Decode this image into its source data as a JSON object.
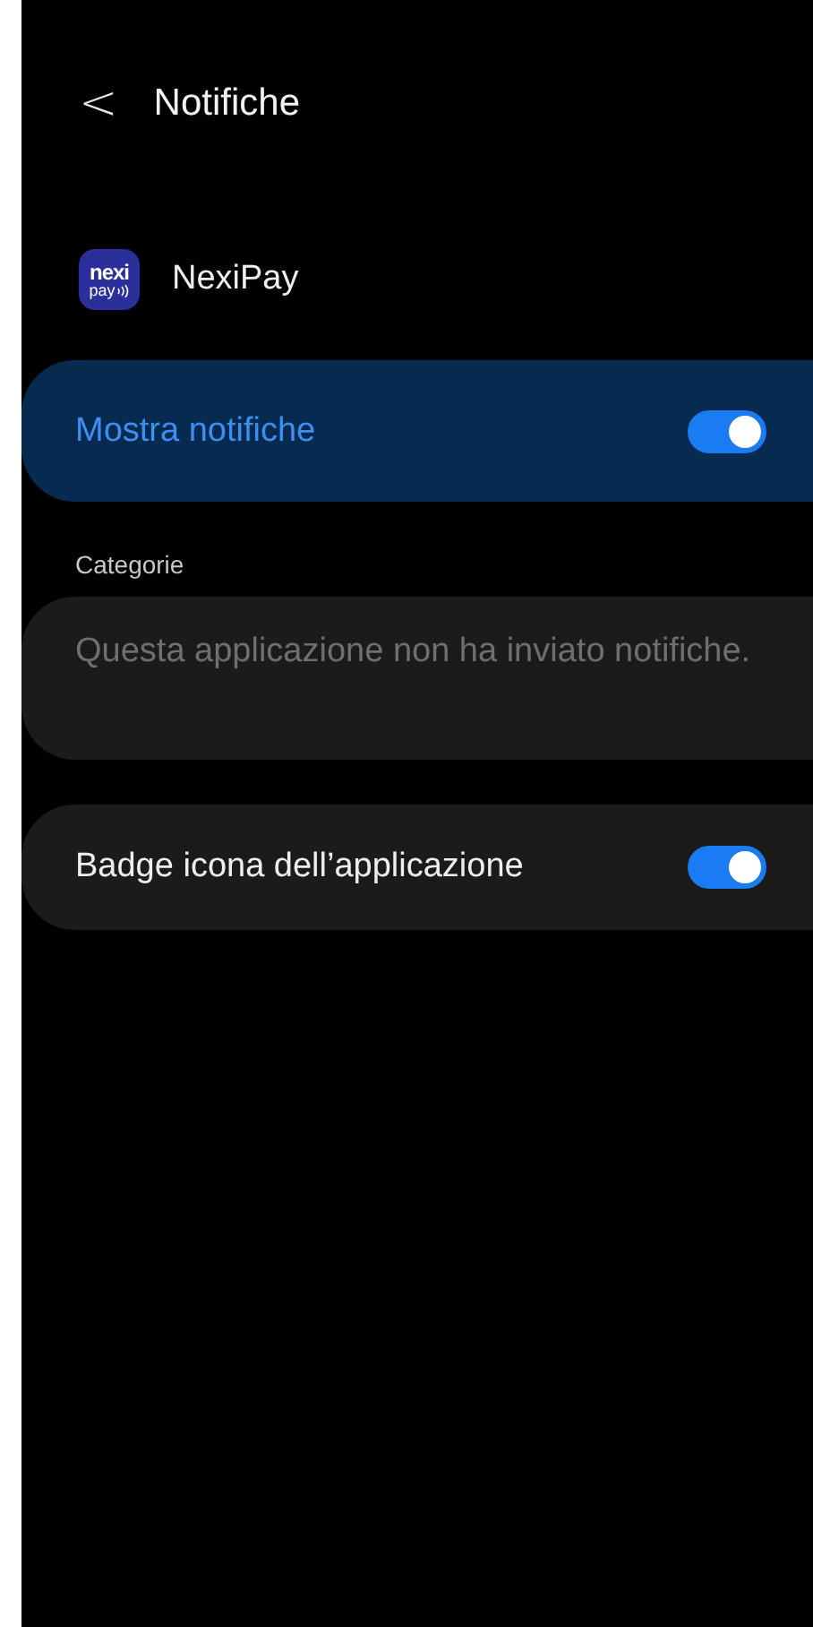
{
  "header": {
    "back": "<",
    "title": "Notifiche"
  },
  "app": {
    "logo_lines": [
      "nexi",
      "pay"
    ],
    "name": "NexiPay"
  },
  "main_toggle": {
    "label": "Mostra notifiche",
    "on": true
  },
  "categories": {
    "heading": "Categorie",
    "empty_text": "Questa applicazione non ha inviato notifiche."
  },
  "settings": [
    {
      "label": "Badge icona dell’applicazione",
      "on": true
    }
  ]
}
